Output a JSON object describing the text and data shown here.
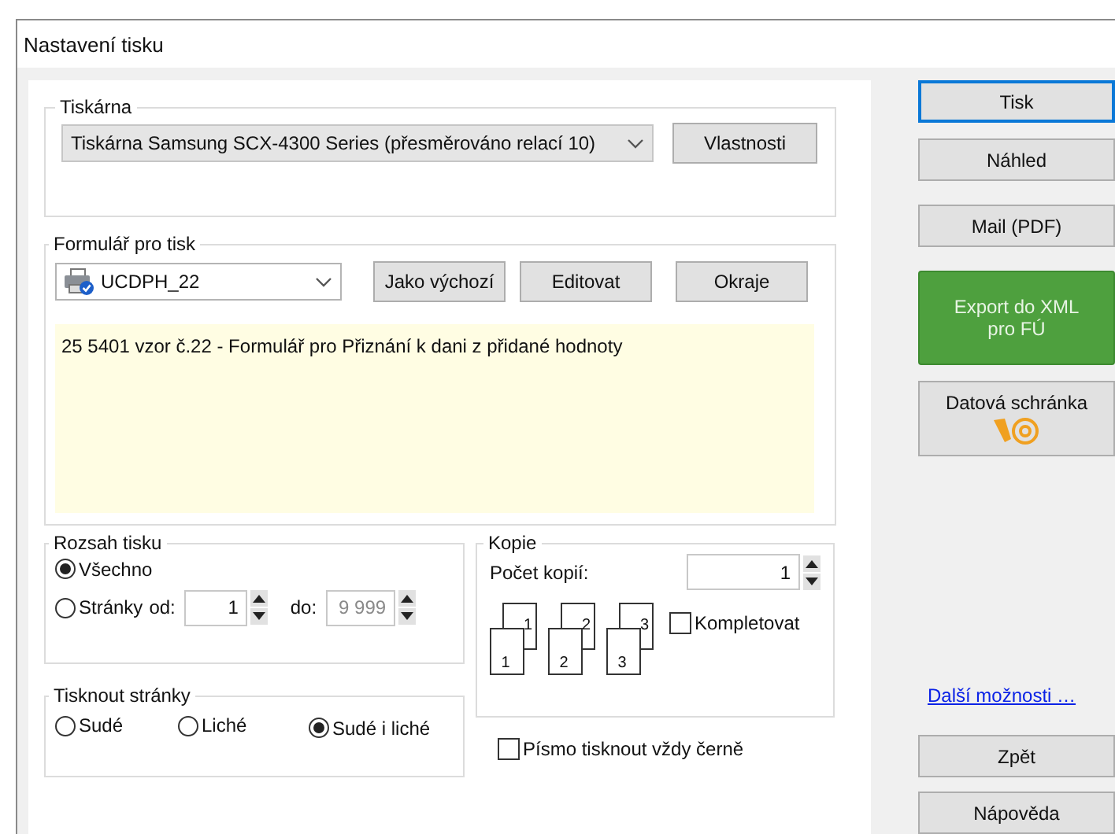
{
  "window": {
    "title": "Nastavení tisku"
  },
  "printer": {
    "label": "Tiskárna",
    "selected_printer": "Tiskárna Samsung SCX-4300 Series (přesměrováno relací 10)",
    "properties_button": "Vlastnosti"
  },
  "form": {
    "label": "Formulář pro tisk",
    "selected_form": "UCDPH_22",
    "buttons": [
      "Jako výchozí",
      "Editovat",
      "Okraje"
    ],
    "description": "25 5401 vzor č.22 - Formulář pro Přiznání k dani z přidané hodnoty"
  },
  "range": {
    "label": "Rozsah tisku",
    "options": [
      {
        "label": "Všechno",
        "selected": true
      },
      {
        "label": "Stránky",
        "selected": false
      }
    ],
    "from_label": "od:",
    "from_value": "1",
    "to_label": "do:",
    "to_value": "9 999",
    "to_disabled": true
  },
  "pages": {
    "label": "Tisknout stránky",
    "options": [
      {
        "label": "Sudé",
        "selected": false
      },
      {
        "label": "Liché",
        "selected": false
      },
      {
        "label": "Sudé i liché",
        "selected": true
      }
    ]
  },
  "copies": {
    "label": "Kopie",
    "count_label": "Počet kopií:",
    "count": "1",
    "stacks": [
      {
        "back": "1",
        "front": "1"
      },
      {
        "back": "2",
        "front": "2"
      },
      {
        "back": "3",
        "front": "3"
      }
    ],
    "collate": {
      "label": "Kompletovat",
      "checked": false
    }
  },
  "black_text": {
    "label": "Písmo tisknout vždy černě",
    "checked": false
  },
  "actions": [
    {
      "label": "Tisk",
      "kind": "default"
    },
    {
      "label": "Náhled",
      "kind": "normal"
    },
    {
      "label": "Mail (PDF)",
      "kind": "normal"
    },
    {
      "label": "Export do XML pro FÚ",
      "kind": "green"
    },
    {
      "label": "Datová schránka",
      "kind": "mailbox"
    }
  ],
  "more_link": "Další možnosti …",
  "bottom_buttons": [
    "Zpět",
    "Nápověda"
  ]
}
